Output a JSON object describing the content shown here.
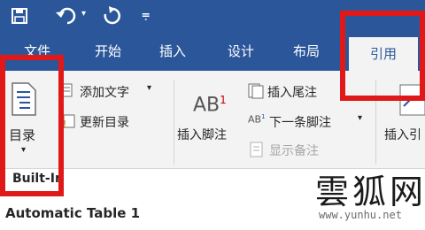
{
  "quick_access": {
    "save_icon": "save-icon",
    "undo_icon": "undo-icon",
    "redo_icon": "redo-icon",
    "customize_icon": "customize-icon"
  },
  "tabs": [
    {
      "label": "文件"
    },
    {
      "label": "开始"
    },
    {
      "label": "插入"
    },
    {
      "label": "设计"
    },
    {
      "label": "布局"
    },
    {
      "label": "引用"
    }
  ],
  "ribbon": {
    "toc_button": "目录",
    "add_text": "添加文字",
    "update_toc": "更新目录",
    "footnote_superscript": "AB",
    "footnote_num": "1",
    "insert_footnote": "插入脚注",
    "insert_endnote": "插入尾注",
    "next_footnote": "下一条脚注",
    "show_notes": "显示备注",
    "insert_citation": "插入引",
    "group_label": "Built-In"
  },
  "document": {
    "heading": "Automatic Table 1"
  },
  "watermark": {
    "name": "雲狐网",
    "url": "www.yunhu.net"
  },
  "colors": {
    "ribbon_blue": "#2b579a",
    "highlight_red": "#e01818",
    "ribbon_bg": "#f3f3f3"
  }
}
